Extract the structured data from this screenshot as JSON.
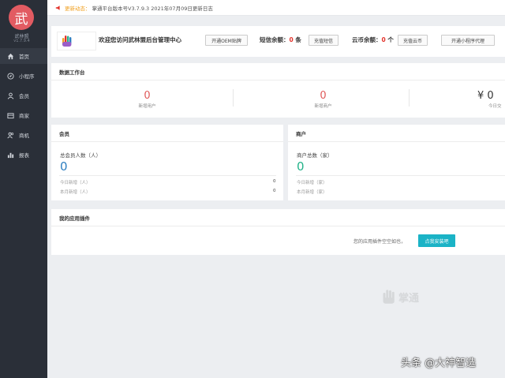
{
  "sidebar": {
    "logo_char": "武",
    "brand": "武林盟",
    "version": "v1.7.9.4",
    "items": [
      {
        "label": "首页",
        "icon": "home-icon"
      },
      {
        "label": "小程序",
        "icon": "compass-icon"
      },
      {
        "label": "会员",
        "icon": "user-icon"
      },
      {
        "label": "商家",
        "icon": "store-icon"
      },
      {
        "label": "商机",
        "icon": "users-icon"
      },
      {
        "label": "报表",
        "icon": "chart-icon"
      }
    ]
  },
  "topbar": {
    "highlight": "更新动态：",
    "text": "掌通平台版本号V3.7.9.3 2021年07月09日更新日志"
  },
  "welcome": {
    "text": "欢迎您访问武林盟后台管理中心",
    "oem_button": "开通OEM贴牌",
    "sms_label": "短信余额：",
    "sms_value": "0",
    "sms_unit": "条",
    "sms_button": "充值短信",
    "coin_label": "云币余额：",
    "coin_value": "0",
    "coin_unit": "个",
    "coin_button": "充值云币",
    "agent_button": "开通小程序代理"
  },
  "workbench": {
    "title": "数据工作台",
    "stats": [
      {
        "value": "0",
        "label": "新增用户"
      },
      {
        "value": "0",
        "label": "新增商户"
      },
      {
        "value": "¥ 0",
        "label": "今日交"
      }
    ]
  },
  "members": {
    "title": "会员",
    "total_label": "总会员人数（人）",
    "total_value": "0",
    "today_label": "今日新增（人）",
    "today_value": "0",
    "month_label": "本月新增（人）",
    "month_value": "0"
  },
  "merchants": {
    "title": "商户",
    "total_label": "商户总数（家）",
    "total_value": "0",
    "today_label": "今日新增（家）",
    "month_label": "本月新增（家）"
  },
  "plugins": {
    "title": "我的应用插件",
    "empty_text": "您的应用插件空空如也，",
    "install_button": "点我安装吧"
  },
  "watermark": "掌通",
  "credit": "头条 @大神智选",
  "colors": {
    "sidebar_bg": "#2a2f38",
    "logo_bg": "#e25b62",
    "accent_red": "#e3322b",
    "stat_red": "#e05a5a",
    "member_blue": "#2e7fc0",
    "merchant_green": "#25b38a",
    "install_btn": "#1bb3c6"
  }
}
